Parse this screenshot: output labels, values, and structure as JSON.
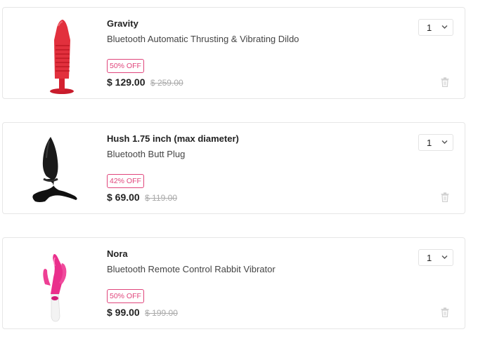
{
  "cart": {
    "items": [
      {
        "name": "Gravity",
        "description": "Bluetooth Automatic Thrusting & Vibrating Dildo",
        "discount": "50% OFF",
        "price": "$ 129.00",
        "original_price": "$ 259.00",
        "quantity": "1",
        "image_icon": "red-thrusting-dildo"
      },
      {
        "name": "Hush 1.75 inch (max diameter)",
        "description": "Bluetooth Butt Plug",
        "discount": "42% OFF",
        "price": "$ 69.00",
        "original_price": "$ 119.00",
        "quantity": "1",
        "image_icon": "black-butt-plug"
      },
      {
        "name": "Nora",
        "description": "Bluetooth Remote Control Rabbit Vibrator",
        "discount": "50% OFF",
        "price": "$ 99.00",
        "original_price": "$ 199.00",
        "quantity": "1",
        "image_icon": "pink-rabbit-vibrator"
      }
    ]
  },
  "colors": {
    "badge": "#e0457b",
    "price": "#222222",
    "original_price": "#a9a9a9",
    "border": "#e6e6e6"
  }
}
